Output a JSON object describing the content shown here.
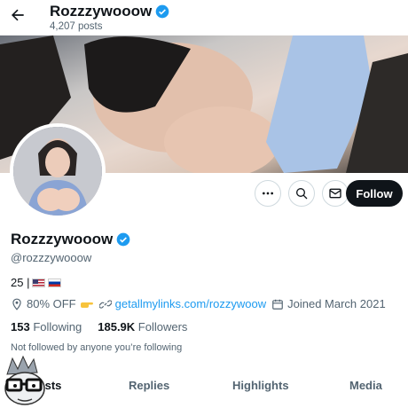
{
  "header": {
    "title": "Rozzzywooow",
    "post_count": "4,207 posts"
  },
  "profile": {
    "name": "Rozzzywooow",
    "handle": "@rozzzywooow",
    "bio_text": "25 |",
    "meta": {
      "promo": "80% OFF",
      "link": "getallmylinks.com/rozzywoow",
      "joined": "Joined March 2021"
    },
    "following_count": "153",
    "following_label": "Following",
    "followers_count": "185.9K",
    "followers_label": "Followers",
    "not_followed_text": "Not followed by anyone you’re following"
  },
  "actions": {
    "follow_label": "Follow"
  },
  "tabs": [
    {
      "label": "Posts"
    },
    {
      "label": "Replies"
    },
    {
      "label": "Highlights"
    },
    {
      "label": "Media"
    }
  ],
  "colors": {
    "accent": "#1d9bf0",
    "text": "#0f1419",
    "muted": "#536471"
  }
}
